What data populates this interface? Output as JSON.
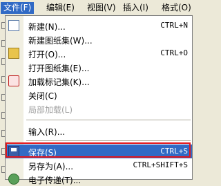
{
  "menubar": {
    "items": [
      "文件(F)",
      "编辑(E)",
      "视图(V)",
      "插入(I)",
      "格式(O)"
    ]
  },
  "menu": {
    "items": [
      {
        "label": "新建(N)...",
        "shortcut": "CTRL+N",
        "icon": "new-file-icon"
      },
      {
        "label": "新建图纸集(W)...",
        "shortcut": "",
        "icon": ""
      },
      {
        "label": "打开(O)...",
        "shortcut": "CTRL+O",
        "icon": "open-folder-icon"
      },
      {
        "label": "打开图纸集(E)...",
        "shortcut": "",
        "icon": ""
      },
      {
        "label": "加载标记集(K)...",
        "shortcut": "",
        "icon": "markup-icon"
      },
      {
        "label": "关闭(C)",
        "shortcut": "",
        "icon": ""
      },
      {
        "label": "局部加载(L)",
        "shortcut": "",
        "icon": "",
        "disabled": true
      },
      {
        "label": "输入(R)...",
        "shortcut": "",
        "icon": ""
      },
      {
        "label": "保存(S)",
        "shortcut": "CTRL+S",
        "icon": "save-icon",
        "highlighted": true
      },
      {
        "label": "另存为(A)...",
        "shortcut": "CTRL+SHIFT+S",
        "icon": ""
      },
      {
        "label": "电子传递(T)...",
        "shortcut": "",
        "icon": "etransmit-icon"
      }
    ]
  },
  "colors": {
    "highlight": "#316ac5",
    "annotation_box": "#e2171c"
  }
}
